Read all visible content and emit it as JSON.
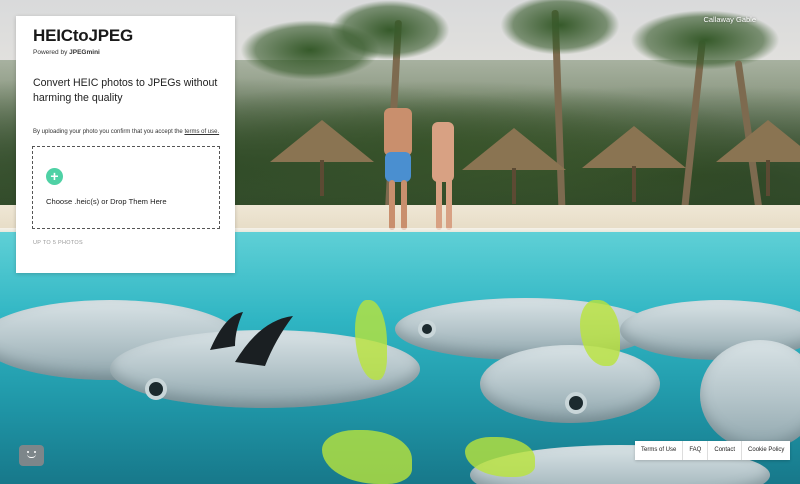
{
  "card": {
    "logo": "HEICtoJPEG",
    "powered_prefix": "Powered by ",
    "powered_brand": "JPEGmini",
    "headline": "Convert HEIC photos to JPEGs without harming the quality",
    "consent_prefix": "By uploading your photo you confirm that you accept the ",
    "consent_link": "terms of use.",
    "dropzone_label": "Choose .heic(s) or Drop Them Here",
    "plus_symbol": "+",
    "limit": "UP TO 5 PHOTOS"
  },
  "credit": "Callaway Gable",
  "footer": {
    "links": [
      "Terms of Use",
      "FAQ",
      "Contact",
      "Cookie Policy"
    ]
  },
  "colors": {
    "accent_green": "#4fd1a5",
    "card_bg": "#ffffff",
    "water": "#2fb5c3"
  },
  "icons": {
    "plus": "plus-circle-icon",
    "chat": "chat-smiley-icon"
  }
}
